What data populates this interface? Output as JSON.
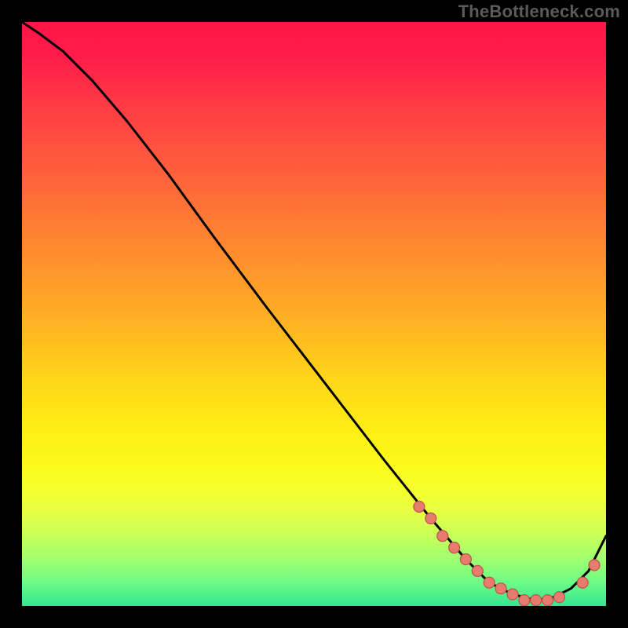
{
  "watermark": "TheBottleneck.com",
  "colors": {
    "frame_background": "#000000",
    "curve": "#000000",
    "dot_fill": "#e97a6e",
    "dot_stroke": "#b95548",
    "watermark_text": "#5b5b5b",
    "gradient_stops": [
      "#ff1548",
      "#ff3a45",
      "#ff7a34",
      "#ffbb20",
      "#ffee14",
      "#f6ff2e",
      "#c8ff5a",
      "#35e592"
    ]
  },
  "chart_data": {
    "type": "line",
    "title": "",
    "xlabel": "",
    "ylabel": "",
    "xlim": [
      0,
      100
    ],
    "ylim": [
      0,
      100
    ],
    "grid": false,
    "legend": false,
    "annotations": [
      "TheBottleneck.com"
    ],
    "series": [
      {
        "name": "bottleneck-curve",
        "x": [
          0,
          3,
          7,
          12,
          18,
          25,
          33,
          42,
          52,
          62,
          70,
          76,
          80,
          84,
          88,
          91,
          94,
          97,
          100
        ],
        "values": [
          100,
          98,
          95,
          90,
          83,
          74,
          63,
          51,
          38,
          25,
          15,
          8,
          4,
          2,
          1,
          1.5,
          3,
          6,
          12
        ]
      },
      {
        "name": "highlighted-points",
        "x": [
          68,
          70,
          72,
          74,
          76,
          78,
          80,
          82,
          84,
          86,
          88,
          90,
          92,
          96,
          98
        ],
        "values": [
          17,
          15,
          12,
          10,
          8,
          6,
          4,
          3,
          2,
          1,
          1,
          1,
          1.5,
          4,
          7
        ]
      }
    ]
  }
}
